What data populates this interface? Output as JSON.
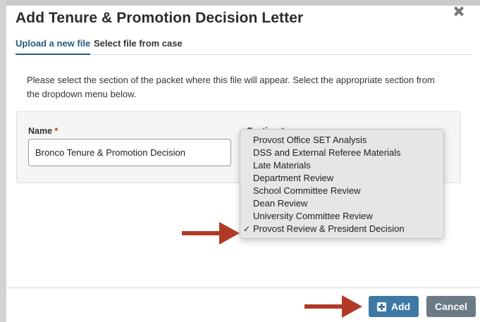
{
  "modal": {
    "title": "Add Tenure & Promotion Decision Letter",
    "close_icon": "close-icon"
  },
  "tabs": [
    {
      "label": "Upload a new file",
      "active": true
    },
    {
      "label": "Select file from case",
      "active": false
    }
  ],
  "instructions": "Please select the section of the packet where this file will appear. Select the appropriate section from the dropdown menu below.",
  "form": {
    "name_label": "Name",
    "section_label": "Section",
    "required_marker": "*",
    "name_value": "Bronco Tenure & Promotion Decision"
  },
  "dropdown": {
    "options": [
      {
        "label": "Provost Office SET Analysis",
        "checked": false
      },
      {
        "label": "DSS and External Referee Materials",
        "checked": false
      },
      {
        "label": "Late Materials",
        "checked": false
      },
      {
        "label": "Department Review",
        "checked": false
      },
      {
        "label": "School Committee Review",
        "checked": false
      },
      {
        "label": "Dean Review",
        "checked": false
      },
      {
        "label": "University Committee Review",
        "checked": false
      },
      {
        "label": "Provost Review & President Decision",
        "checked": true
      }
    ],
    "check_glyph": "✓"
  },
  "buttons": {
    "add_label": "Add",
    "cancel_label": "Cancel"
  },
  "colors": {
    "accent": "#215c83",
    "add_button": "#3e79a6",
    "cancel_button": "#6c7a86",
    "annotation_arrow": "#b03a26"
  }
}
